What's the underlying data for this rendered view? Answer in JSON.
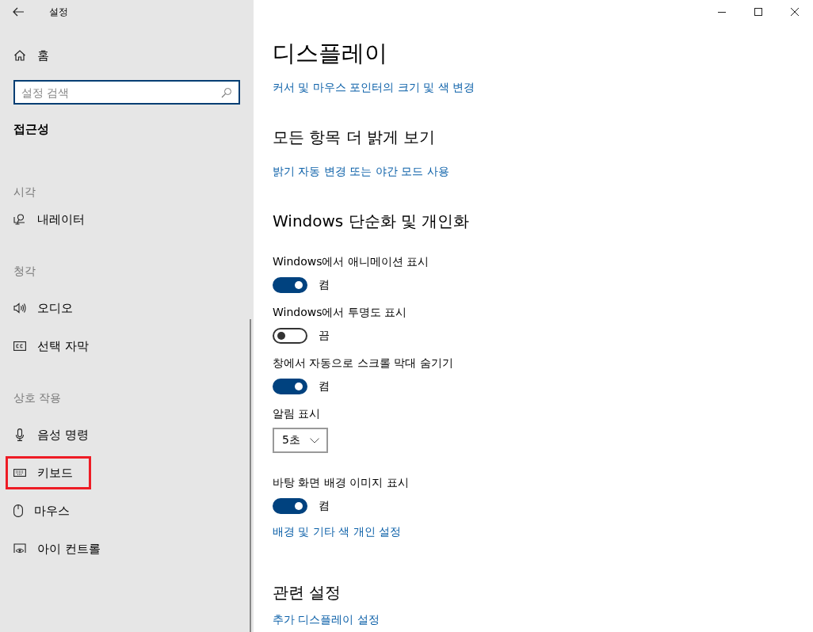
{
  "window": {
    "title": "설정"
  },
  "sidebar": {
    "home": "홈",
    "search": {
      "placeholder": "설정 검색"
    },
    "category": "접근성",
    "groups": [
      {
        "heading": "시각",
        "items": [
          {
            "label": "내레이터",
            "kind": "narrator",
            "highlighted": false
          }
        ]
      },
      {
        "heading": "청각",
        "items": [
          {
            "label": "오디오",
            "kind": "audio",
            "highlighted": false
          },
          {
            "label": "선택 자막",
            "kind": "cc",
            "highlighted": false
          }
        ]
      },
      {
        "heading": "상호 작용",
        "items": [
          {
            "label": "음성 명령",
            "kind": "mic",
            "highlighted": false
          },
          {
            "label": "키보드",
            "kind": "keyboard",
            "highlighted": true
          },
          {
            "label": "마우스",
            "kind": "mouse",
            "highlighted": false
          },
          {
            "label": "아이 컨트롤",
            "kind": "eye",
            "highlighted": false
          }
        ]
      }
    ]
  },
  "content": [
    {
      "kind": "title",
      "text": "디스플레이"
    },
    {
      "kind": "link",
      "text": "커서 및 마우스 포인터의 크기 및 색 변경"
    },
    {
      "kind": "heading",
      "text": "모든 항목 더 밝게 보기"
    },
    {
      "kind": "link",
      "text": "밝기 자동 변경 또는 야간 모드 사용"
    },
    {
      "kind": "heading",
      "text": "Windows 단순화 및 개인화"
    },
    {
      "kind": "toggle",
      "label": "Windows에서 애니메이션 표시",
      "on": true,
      "state_text": "켬"
    },
    {
      "kind": "toggle",
      "label": "Windows에서 투명도 표시",
      "on": false,
      "state_text": "끔"
    },
    {
      "kind": "toggle",
      "label": "창에서 자동으로 스크롤 막대 숨기기",
      "on": true,
      "state_text": "켬"
    },
    {
      "kind": "dropdown",
      "label": "알림 표시",
      "value": "5초"
    },
    {
      "kind": "toggle",
      "label": "바탕 화면 배경 이미지 표시",
      "on": true,
      "state_text": "켬"
    },
    {
      "kind": "link",
      "text": "배경 및 기타 색 개인 설정"
    },
    {
      "kind": "heading",
      "text": "관련 설정"
    },
    {
      "kind": "link",
      "text": "추가 디스플레이 설정"
    }
  ]
}
